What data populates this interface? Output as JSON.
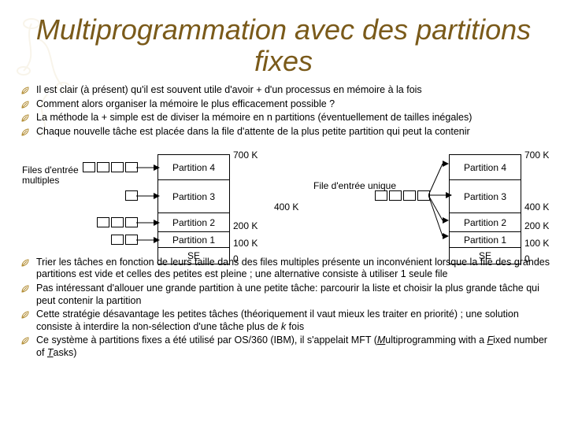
{
  "title": "Multiprogrammation avec des partitions fixes",
  "bullets": [
    "Il est clair (à présent) qu'il est souvent utile d'avoir + d'un processus en mémoire à la fois",
    "Comment alors organiser la mémoire le plus efficacement possible ?",
    "La méthode la + simple est de diviser la mémoire en n partitions (éventuellement de tailles inégales)",
    "Chaque nouvelle tâche est placée dans la file d'attente de la plus petite partition qui peut la contenir",
    "",
    "Trier les tâches en fonction de leurs taille dans des files multiples présente un inconvénient lorsque la file des grandes partitions est vide et celles des petites est pleine ; une alternative consiste à utiliser 1 seule file",
    "Pas intéressant d'allouer une grande partition à une petite tâche: parcourir la liste et choisir la plus grande tâche qui peut contenir la partition",
    "Cette stratégie désavantage les petites tâches (théoriquement il vaut mieux les traiter en priorité) ; une solution consiste à interdire la non-sélection d'une tâche plus de k fois",
    "Ce système à partitions fixes a été utilisé par OS/360 (IBM), il s'appelait MFT (Multiprogramming with a Fixed number of Tasks)"
  ],
  "diagram": {
    "leftCaption": "Files d'entrée multiples",
    "rightCaption": "File d'entrée unique",
    "partitions": [
      "Partition 4",
      "Partition 3",
      "Partition 2",
      "Partition 1",
      "SE"
    ],
    "sizes": [
      "700 K",
      "400 K",
      "200 K",
      "100 K",
      "0"
    ]
  }
}
